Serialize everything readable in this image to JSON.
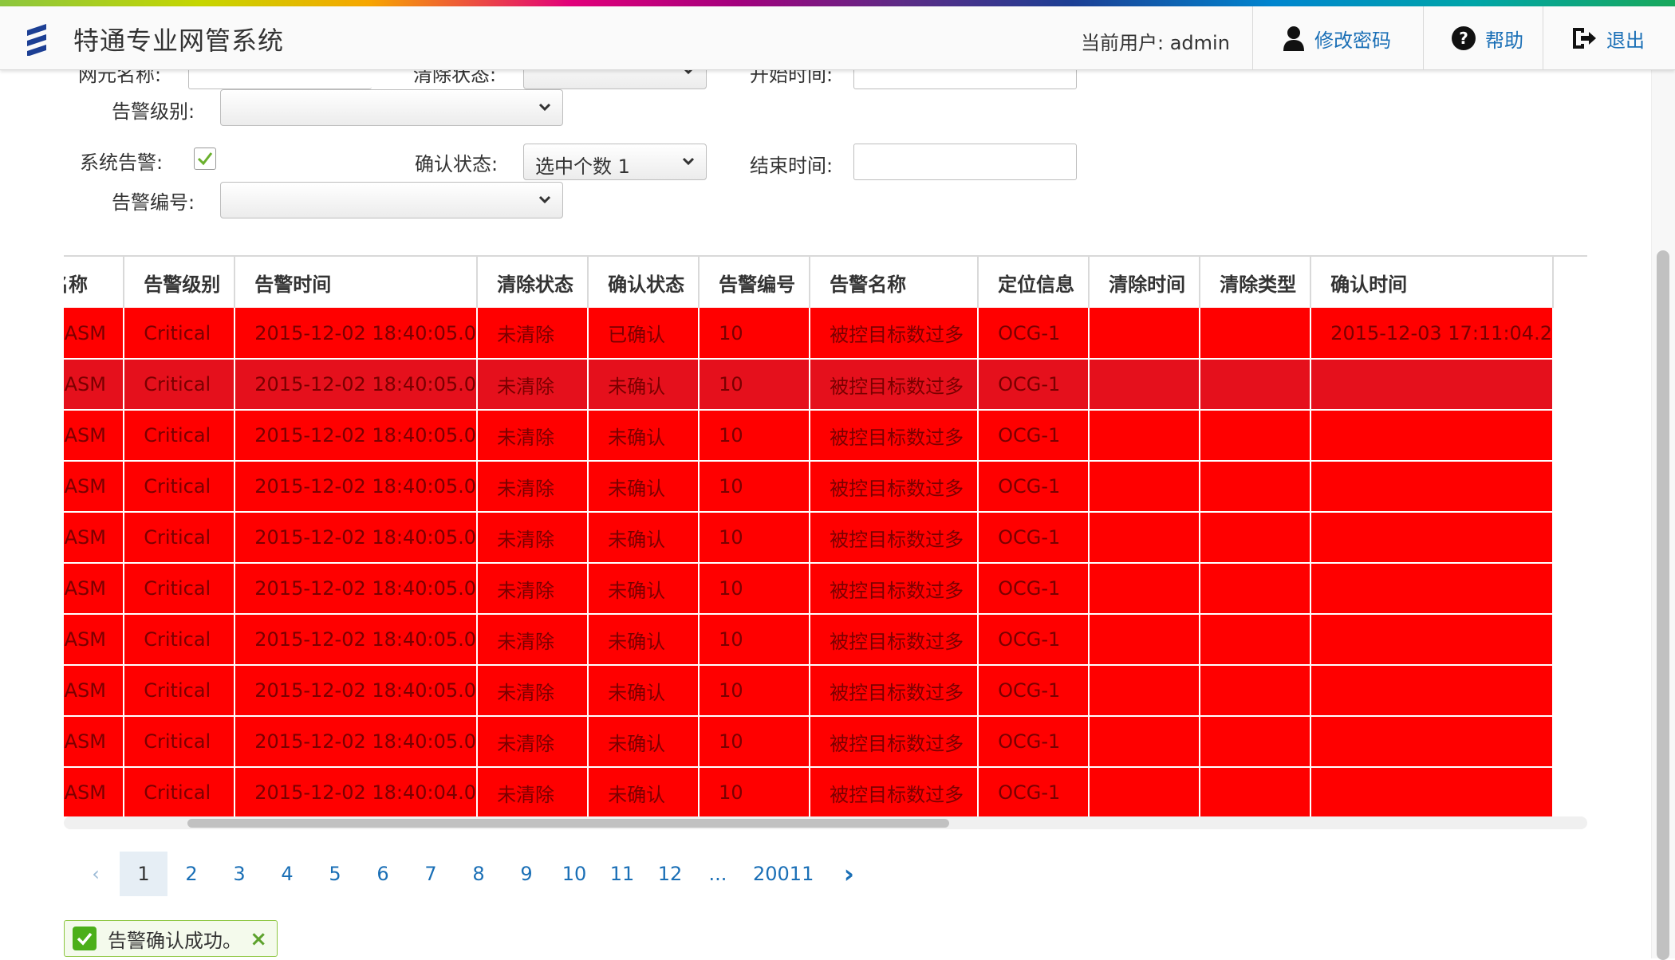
{
  "header": {
    "app_title": "特通专业网管系统",
    "current_user": "当前用户: admin",
    "change_password": "修改密码",
    "help": "帮助",
    "logout": "退出"
  },
  "filters": {
    "ne_name_label": "网元名称:",
    "clear_status_label": "清除状态:",
    "start_time_label": "开始时间:",
    "level_label": "告警级别:",
    "system_alarm_label": "系统告警:",
    "confirm_status_label": "确认状态:",
    "confirm_status_value": "选中个数 1",
    "end_time_label": "结束时间:",
    "alarm_no_label": "告警编号:"
  },
  "table": {
    "columns": [
      "名称",
      "告警级别",
      "告警时间",
      "清除状态",
      "确认状态",
      "告警编号",
      "告警名称",
      "定位信息",
      "清除时间",
      "清除类型",
      "确认时间"
    ],
    "rows": [
      [
        "GASM",
        "Critical",
        "2015-12-02 18:40:05.0",
        "未清除",
        "已确认",
        "10",
        "被控目标数过多",
        "OCG-1",
        "",
        "",
        "2015-12-03 17:11:04.2"
      ],
      [
        "GASM",
        "Critical",
        "2015-12-02 18:40:05.0",
        "未清除",
        "未确认",
        "10",
        "被控目标数过多",
        "OCG-1",
        "",
        "",
        ""
      ],
      [
        "GASM",
        "Critical",
        "2015-12-02 18:40:05.0",
        "未清除",
        "未确认",
        "10",
        "被控目标数过多",
        "OCG-1",
        "",
        "",
        ""
      ],
      [
        "GASM",
        "Critical",
        "2015-12-02 18:40:05.0",
        "未清除",
        "未确认",
        "10",
        "被控目标数过多",
        "OCG-1",
        "",
        "",
        ""
      ],
      [
        "GASM",
        "Critical",
        "2015-12-02 18:40:05.0",
        "未清除",
        "未确认",
        "10",
        "被控目标数过多",
        "OCG-1",
        "",
        "",
        ""
      ],
      [
        "GASM",
        "Critical",
        "2015-12-02 18:40:05.0",
        "未清除",
        "未确认",
        "10",
        "被控目标数过多",
        "OCG-1",
        "",
        "",
        ""
      ],
      [
        "GASM",
        "Critical",
        "2015-12-02 18:40:05.0",
        "未清除",
        "未确认",
        "10",
        "被控目标数过多",
        "OCG-1",
        "",
        "",
        ""
      ],
      [
        "GASM",
        "Critical",
        "2015-12-02 18:40:05.0",
        "未清除",
        "未确认",
        "10",
        "被控目标数过多",
        "OCG-1",
        "",
        "",
        ""
      ],
      [
        "GASM",
        "Critical",
        "2015-12-02 18:40:05.0",
        "未清除",
        "未确认",
        "10",
        "被控目标数过多",
        "OCG-1",
        "",
        "",
        ""
      ],
      [
        "GASM",
        "Critical",
        "2015-12-02 18:40:04.0",
        "未清除",
        "未确认",
        "10",
        "被控目标数过多",
        "OCG-1",
        "",
        "",
        ""
      ]
    ],
    "row_color": "#ff0000",
    "selected_row_color": "#e5101c"
  },
  "pagination": {
    "prev": "‹",
    "pages": [
      "1",
      "2",
      "3",
      "4",
      "5",
      "6",
      "7",
      "8",
      "9",
      "10",
      "11",
      "12"
    ],
    "current": "1",
    "ellipsis": "...",
    "last": "20011",
    "next": "›"
  },
  "toast": {
    "message": "告警确认成功。",
    "close": "×"
  },
  "icons": {
    "logo": "ericsson-logo-icon",
    "user": "user-icon",
    "help": "question-circle-icon",
    "logout": "sign-out-icon",
    "check": "check-icon",
    "chevron": "chevron-down-icon"
  },
  "colors": {
    "link": "#1a6fb6",
    "alarm_row": "#ff0000",
    "success": "#4caf1a"
  }
}
